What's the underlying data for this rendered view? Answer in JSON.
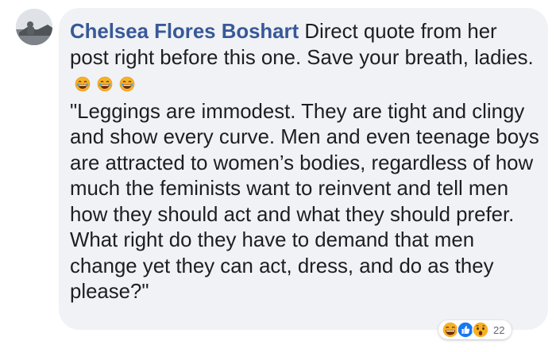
{
  "comment": {
    "author": "Chelsea Flores Boshart",
    "intro_text": "Direct quote from her post right before this one. Save your breath, ladies.",
    "inline_emojis": [
      "laughing-emoji-icon",
      "laughing-emoji-icon",
      "laughing-emoji-icon"
    ],
    "quote_text": "\"Leggings are immodest. They are tight and clingy and show every curve. Men and even teenage boys are attracted to women’s bodies, regardless of how much the feminists want to reinvent and tell men how they should act and what they should prefer. What right do they have to demand that men change yet they can act, dress, and do as they please?\""
  },
  "reactions": {
    "icons": [
      "haha-reaction-icon",
      "like-reaction-icon",
      "wow-reaction-icon"
    ],
    "count": "22"
  },
  "colors": {
    "author": "#385898",
    "bubble": "#f0f2f5",
    "text": "#1c1e21",
    "like_blue": "#1877f2",
    "emoji_yellow": "#f7b125"
  }
}
